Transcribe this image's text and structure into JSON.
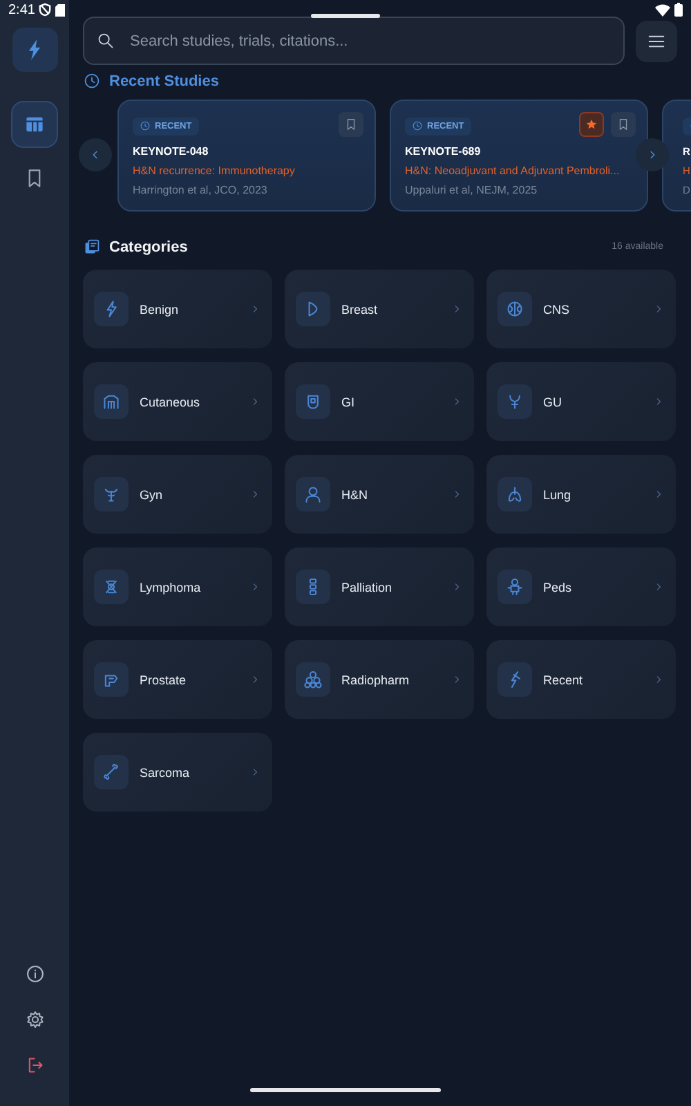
{
  "status_bar": {
    "time": "2:41"
  },
  "sidebar": {
    "items": [
      {
        "kind": "grid",
        "selected": true
      },
      {
        "kind": "bookmark",
        "selected": false
      }
    ]
  },
  "search": {
    "placeholder": "Search studies, trials, citations..."
  },
  "recent": {
    "title": "Recent Studies",
    "cards": [
      {
        "badge": "RECENT",
        "trial": "KEYNOTE-048",
        "subtitle": "H&N recurrence: Immunotherapy",
        "citation": "Harrington et al, JCO, 2023",
        "starred": false
      },
      {
        "badge": "RECENT",
        "trial": "KEYNOTE-689",
        "subtitle": "H&N: Neoadjuvant and Adjuvant Pembroli...",
        "citation": "Uppaluri et al, NEJM, 2025",
        "starred": true
      },
      {
        "trial": "R",
        "subtitle": "H",
        "citation": "D"
      }
    ]
  },
  "categories": {
    "title": "Categories",
    "count": "16 available",
    "items": [
      {
        "label": "Benign"
      },
      {
        "label": "Breast"
      },
      {
        "label": "CNS"
      },
      {
        "label": "Cutaneous"
      },
      {
        "label": "GI"
      },
      {
        "label": "GU"
      },
      {
        "label": "Gyn"
      },
      {
        "label": "H&N"
      },
      {
        "label": "Lung"
      },
      {
        "label": "Lymphoma"
      },
      {
        "label": "Palliation"
      },
      {
        "label": "Peds"
      },
      {
        "label": "Prostate"
      },
      {
        "label": "Radiopharm"
      },
      {
        "label": "Recent"
      },
      {
        "label": "Sarcoma"
      }
    ]
  }
}
